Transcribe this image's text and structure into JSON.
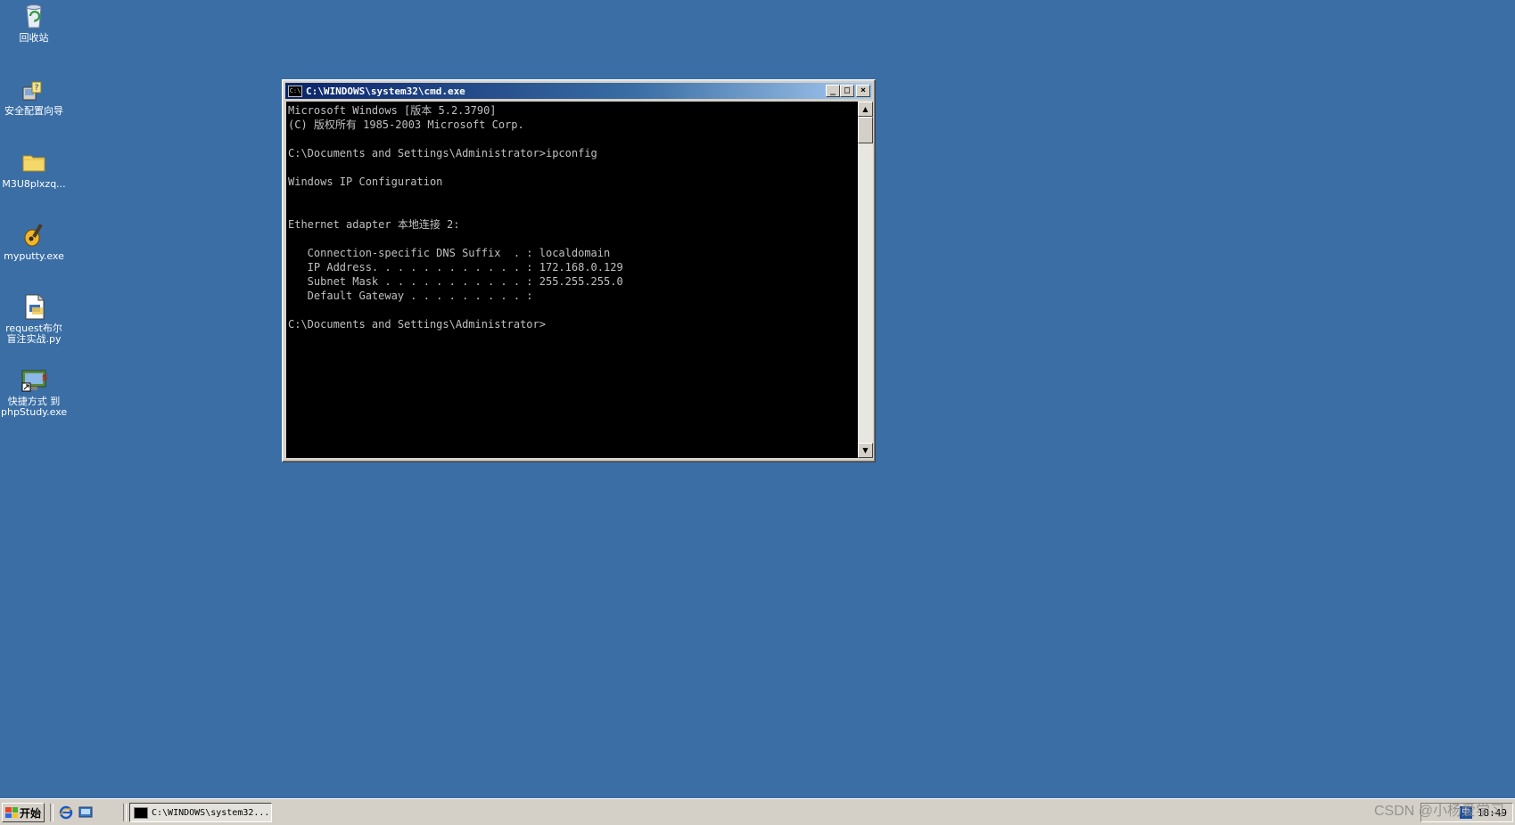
{
  "desktop": {
    "icons": [
      {
        "label": "回收站",
        "icon": "recycle-bin-icon"
      },
      {
        "label": "安全配置向导",
        "icon": "security-wizard-icon"
      },
      {
        "label": "M3U8plxzq...",
        "icon": "folder-icon"
      },
      {
        "label": "myputty.exe",
        "icon": "putty-icon"
      },
      {
        "label": "request布尔\n盲注实战.py",
        "icon": "python-file-icon"
      },
      {
        "label": "快捷方式 到\nphpStudy.exe",
        "icon": "phpstudy-shortcut-icon"
      }
    ]
  },
  "window": {
    "title": "C:\\WINDOWS\\system32\\cmd.exe",
    "title_icon_text": "C:\\",
    "buttons": {
      "minimize": "_",
      "maximize": "□",
      "close": "×"
    },
    "console_lines": [
      "Microsoft Windows [版本 5.2.3790]",
      "(C) 版权所有 1985-2003 Microsoft Corp.",
      "",
      "C:\\Documents and Settings\\Administrator>ipconfig",
      "",
      "Windows IP Configuration",
      "",
      "",
      "Ethernet adapter 本地连接 2:",
      "",
      "   Connection-specific DNS Suffix  . : localdomain",
      "   IP Address. . . . . . . . . . . . : 172.168.0.129",
      "   Subnet Mask . . . . . . . . . . . : 255.255.255.0",
      "   Default Gateway . . . . . . . . . :",
      "",
      "C:\\Documents and Settings\\Administrator>"
    ],
    "scroll_up": "▲",
    "scroll_down": "▼"
  },
  "taskbar": {
    "start_label": "开始",
    "task_item_label": "C:\\WINDOWS\\system32...",
    "clock": "18:49",
    "tray_icon_text": "中"
  },
  "watermark": "CSDN @小杨爱学习",
  "colors": {
    "desktop": "#3a6ea5",
    "taskbar": "#d4d0c8",
    "console_bg": "#000000",
    "console_fg": "#c0c0c0"
  }
}
